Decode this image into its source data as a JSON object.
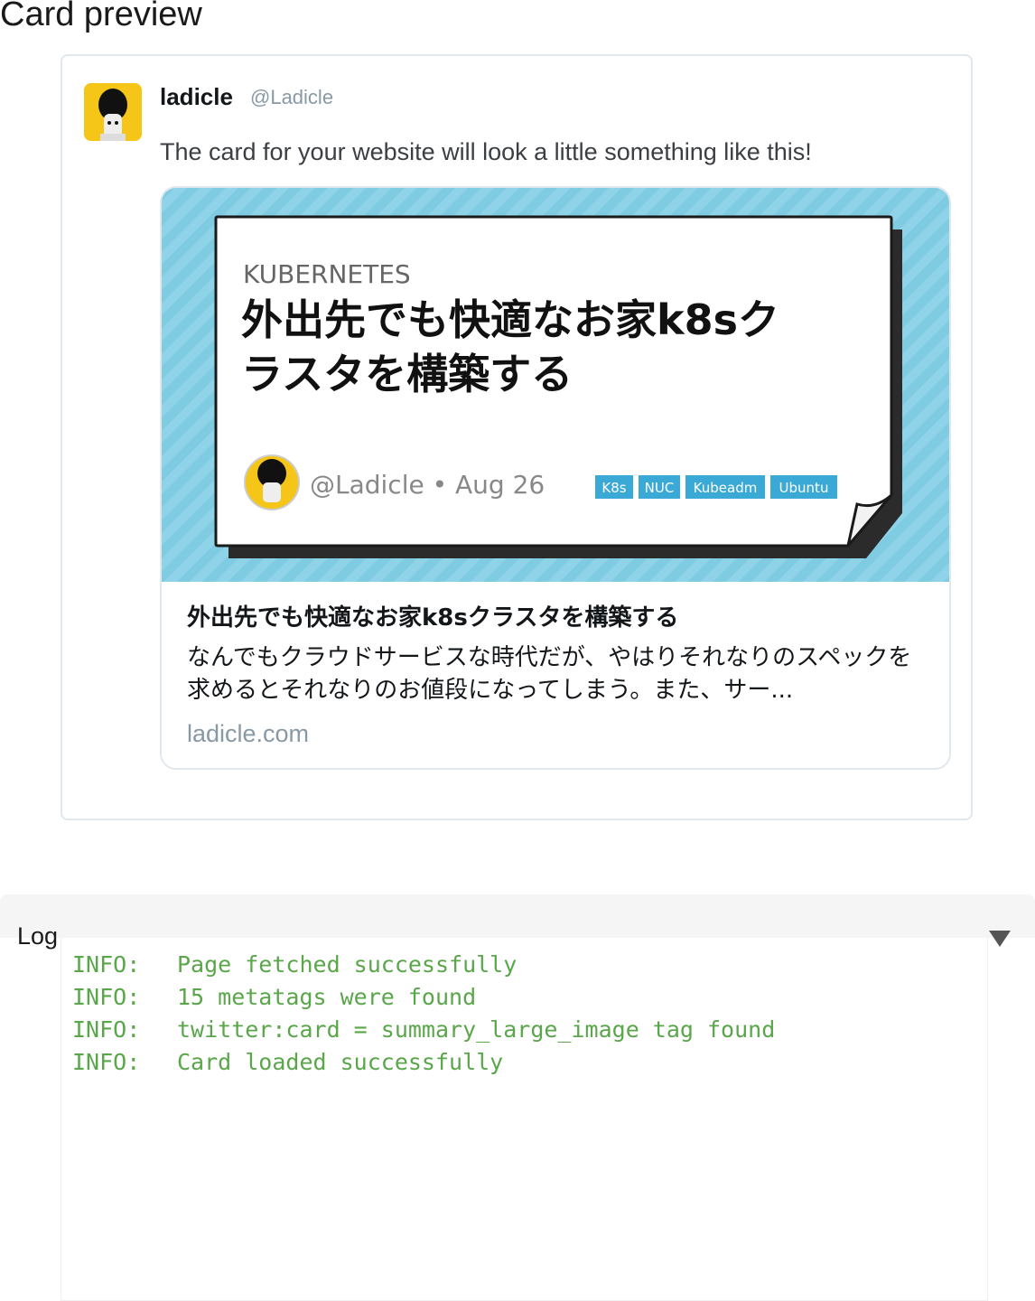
{
  "page": {
    "title": "Card preview"
  },
  "tweet": {
    "name": "ladicle",
    "handle": "@Ladicle",
    "text": "The card for your website will look a little something like this!"
  },
  "card": {
    "image": {
      "category": "KUBERNETES",
      "headline_line1": "外出先でも快適なお家k8sク",
      "headline_line2": "ラスタを構築する",
      "byline": "@Ladicle • Aug 26",
      "tags": [
        "K8s",
        "NUC",
        "Kubeadm",
        "Ubuntu"
      ]
    },
    "title": "外出先でも快適なお家k8sクラスタを構築する",
    "description": "なんでもクラウドサービスな時代だが、やはりそれなりのスペックを求めるとそれなりのお値段になってしまう。また、サー...",
    "domain": "ladicle.com"
  },
  "log": {
    "label": "Log",
    "toggle_icon": "triangle-down-icon",
    "lines": [
      {
        "level": "INFO:",
        "message": "Page fetched successfully"
      },
      {
        "level": "INFO:",
        "message": "15 metatags were found"
      },
      {
        "level": "INFO:",
        "message": "twitter:card = summary_large_image tag found"
      },
      {
        "level": "INFO:",
        "message": "Card loaded successfully"
      }
    ]
  },
  "colors": {
    "log_text": "#5aa64a",
    "card_image_bg": "#7fcbe2",
    "tag_bg": "#3aa9d6",
    "muted": "#8899a6"
  }
}
